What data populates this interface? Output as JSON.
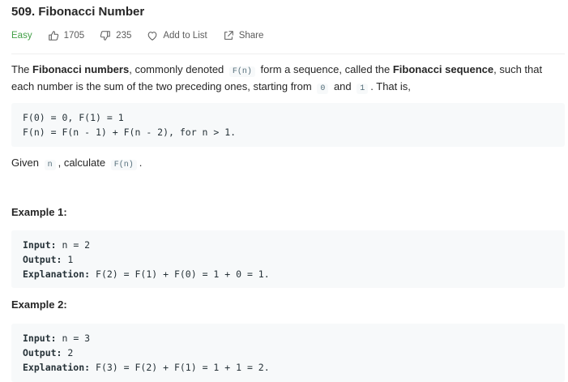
{
  "problem": {
    "title": "509. Fibonacci Number",
    "difficulty": "Easy",
    "likes": "1705",
    "dislikes": "235",
    "add_to_list": "Add to List",
    "share": "Share",
    "colors": {
      "difficulty_easy": "#43a047",
      "code_bg": "#f7f9fa"
    }
  },
  "description": {
    "p1_a": "The ",
    "p1_b": "Fibonacci numbers",
    "p1_c": ", commonly denoted ",
    "p1_code1": "F(n)",
    "p1_d": " form a sequence, called the ",
    "p1_e": "Fibonacci sequence",
    "p1_f": ", such that each number is the sum of the two preceding ones, starting from ",
    "p1_code2": "0",
    "p1_g": " and ",
    "p1_code3": "1",
    "p1_h": ". That is,",
    "formula_line1": "F(0) = 0, F(1) = 1",
    "formula_line2": "F(n) = F(n - 1) + F(n - 2), for n > 1.",
    "given_a": "Given ",
    "given_code1": "n",
    "given_b": ", calculate ",
    "given_code2": "F(n)",
    "given_c": "."
  },
  "examples": [
    {
      "heading": "Example 1:",
      "input_label": "Input:",
      "input_value": " n = 2",
      "output_label": "Output:",
      "output_value": " 1",
      "explanation_label": "Explanation:",
      "explanation_value": " F(2) = F(1) + F(0) = 1 + 0 = 1."
    },
    {
      "heading": "Example 2:",
      "input_label": "Input:",
      "input_value": " n = 3",
      "output_label": "Output:",
      "output_value": " 2",
      "explanation_label": "Explanation:",
      "explanation_value": " F(3) = F(2) + F(1) = 1 + 1 = 2."
    }
  ]
}
